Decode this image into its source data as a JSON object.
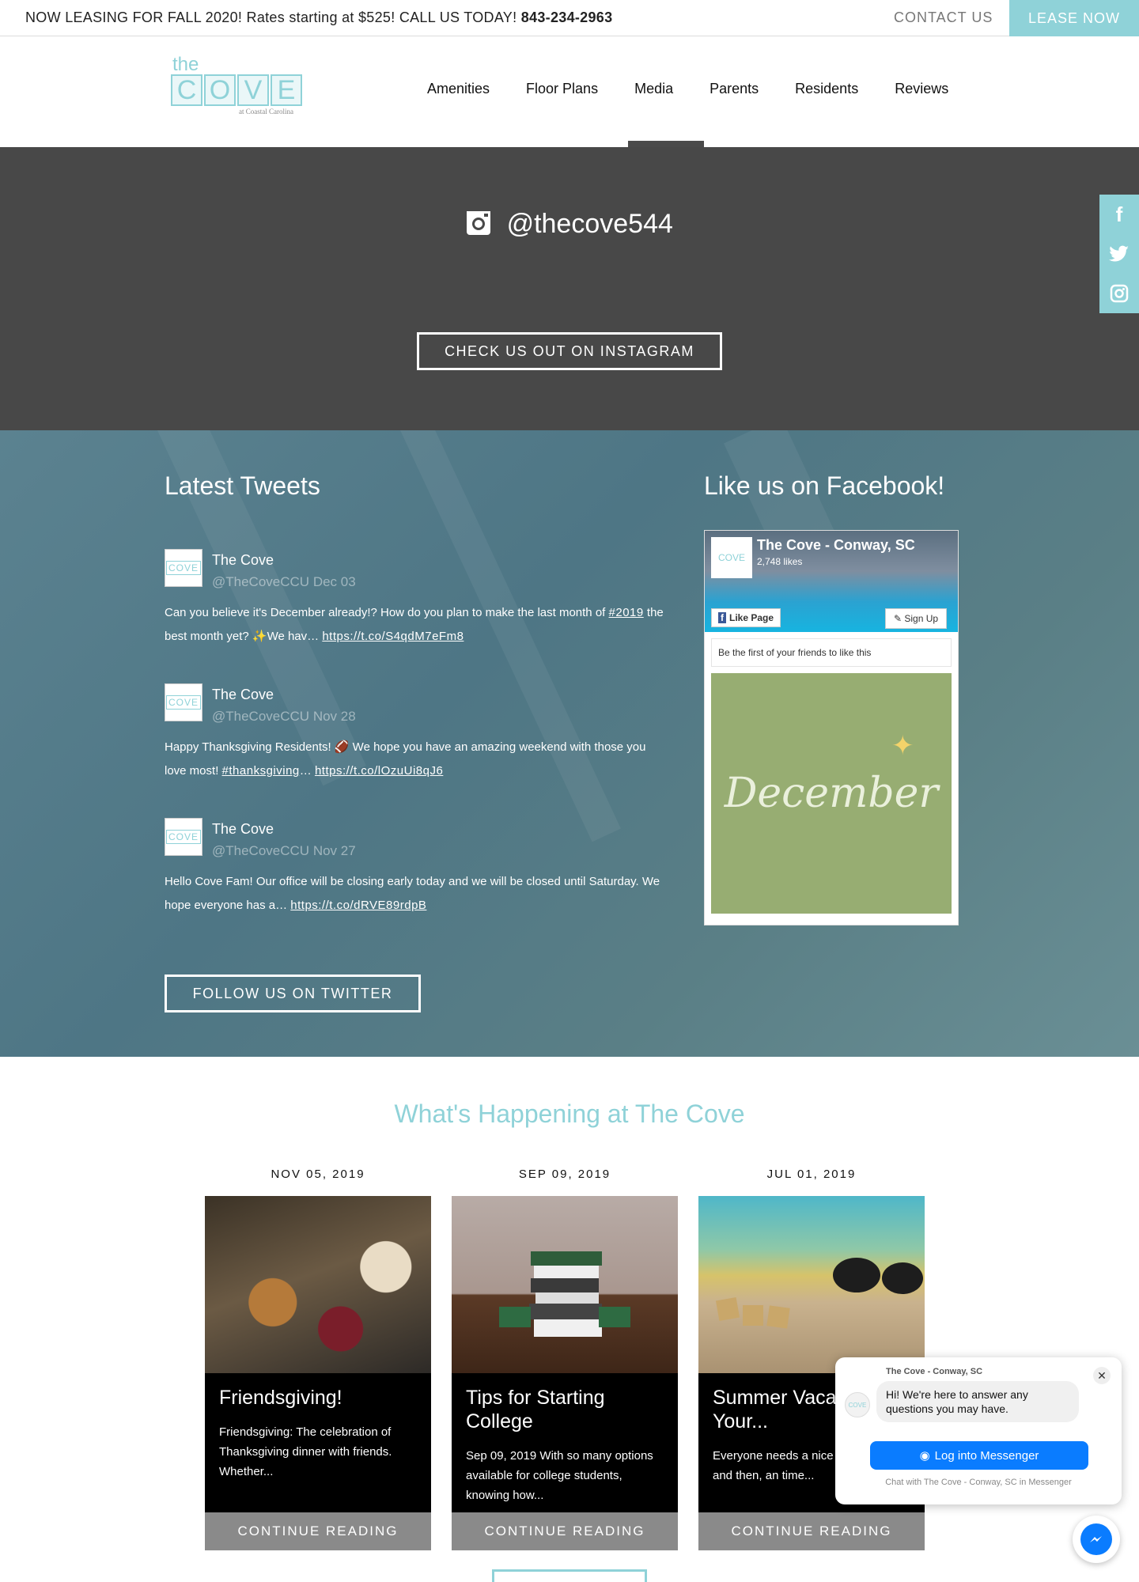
{
  "topbar": {
    "promo": "NOW LEASING FOR FALL 2020! Rates starting at $525! CALL US TODAY!",
    "phone": "843-234-2963",
    "contact": "CONTACT US",
    "lease": "LEASE NOW"
  },
  "logo": {
    "the": "the",
    "letters": [
      "C",
      "O",
      "V",
      "E"
    ],
    "sub": "at Coastal Carolina"
  },
  "nav": [
    "Amenities",
    "Floor Plans",
    "Media",
    "Parents",
    "Residents",
    "Reviews"
  ],
  "instagram": {
    "handle": "@thecove544",
    "button": "CHECK US OUT ON INSTAGRAM"
  },
  "social_rail": [
    "f",
    "t",
    "ig"
  ],
  "tweets_section": {
    "title": "Latest Tweets",
    "tweets": [
      {
        "name": "The Cove",
        "handle": "@TheCoveCCU",
        "date": "Dec 03",
        "text": "Can you believe it's December already!? How do you plan to make the last month of",
        "hashtag": "#2019",
        "text2": "the best month yet? ✨We hav…",
        "link": "https://t.co/S4qdM7eFm8"
      },
      {
        "name": "The Cove",
        "handle": "@TheCoveCCU",
        "date": "Nov 28",
        "text": "Happy Thanksgiving Residents! 🏈 We hope you have an amazing weekend with those you love most!",
        "hashtag": "#thanksgiving",
        "text2": "…",
        "link": "https://t.co/lOzuUi8qJ6"
      },
      {
        "name": "The Cove",
        "handle": "@TheCoveCCU",
        "date": "Nov 27",
        "text": "Hello Cove Fam! Our office will be closing early today and we will be closed until Saturday. We hope everyone has a…",
        "hashtag": "",
        "text2": "",
        "link": "https://t.co/dRVE89rdpB"
      }
    ],
    "button": "FOLLOW US ON TWITTER"
  },
  "facebook": {
    "title": "Like us on Facebook!",
    "page_name": "The Cove - Conway, SC",
    "likes": "2,748 likes",
    "like_button": "Like Page",
    "signup_button": "Sign Up",
    "friends_text": "Be the first of your friends to like this",
    "post_text": "December"
  },
  "happening": {
    "title": "What's Happening at The Cove",
    "cards": [
      {
        "date": "NOV 05, 2019",
        "title": "Friendsgiving!",
        "excerpt": "Friendsgiving: The celebration of Thanksgiving dinner with friends. Whether...",
        "cta": "CONTINUE READING"
      },
      {
        "date": "SEP 09, 2019",
        "title": "Tips for Starting College",
        "excerpt": "Sep 09, 2019 With so many options available for college students, knowing how...",
        "cta": "CONTINUE READING"
      },
      {
        "date": "JUL 01, 2019",
        "title": "Summer Vacat Keep Your...",
        "excerpt": "Everyone needs a nice r every now and then, an time...",
        "cta": "CONTINUE READING"
      }
    ]
  },
  "messenger": {
    "page": "The Cove - Conway, SC",
    "greeting": "Hi! We're here to answer any questions you may have.",
    "login": "Log into Messenger",
    "footer": "Chat with The Cove - Conway, SC in Messenger"
  },
  "colors": {
    "accent": "#8fd2d8",
    "dark_band": "#484848",
    "messenger_blue": "#0a7cff"
  }
}
